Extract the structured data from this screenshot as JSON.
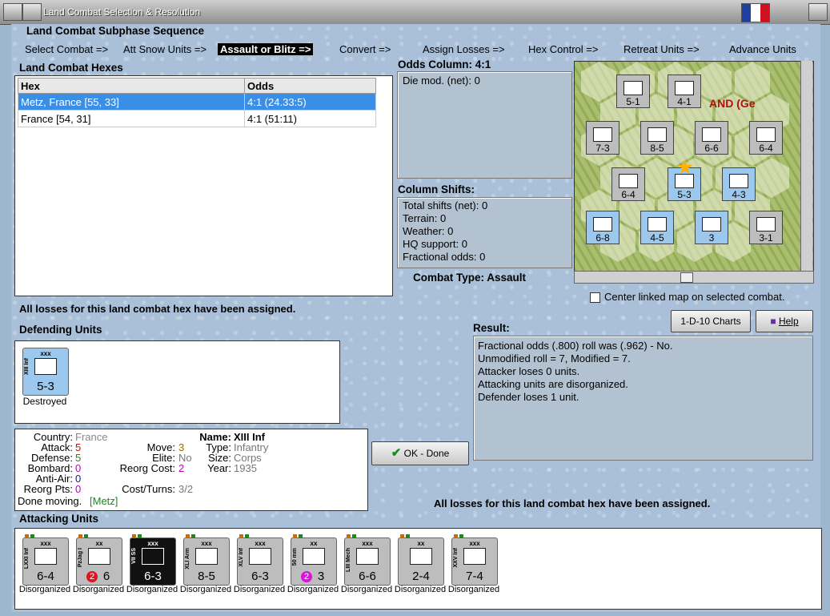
{
  "window": {
    "title": "Land Combat Selection & Resolution"
  },
  "sequence": {
    "header": "Land Combat Subphase Sequence",
    "steps": [
      "Select Combat =>",
      "Att Snow Units =>",
      "Assault or Blitz =>",
      "Convert =>",
      "Assign Losses =>",
      "Hex Control =>",
      "Retreat Units =>",
      "Advance Units"
    ],
    "active_index": 2
  },
  "hexes": {
    "header": "Land Combat Hexes",
    "columns": [
      "Hex",
      "Odds"
    ],
    "rows": [
      {
        "hex": "Metz, France [55, 33]",
        "odds": "4:1 (24.33:5)"
      },
      {
        "hex": "France [54, 31]",
        "odds": "4:1 (51:11)"
      }
    ]
  },
  "odds": {
    "label": "Odds Column: 4:1",
    "die_mod": "Die mod. (net): 0"
  },
  "shifts": {
    "header": "Column Shifts:",
    "lines": [
      "Total shifts (net): 0",
      "Terrain: 0",
      "Weather: 0",
      "HQ support: 0",
      "Fractional odds: 0"
    ]
  },
  "combat_type": "Combat Type:  Assault",
  "map": {
    "overlay_text": "AND (Ge",
    "center_label": "Center linked map on selected combat.",
    "units": [
      {
        "size": "xxx",
        "str": "5-1"
      },
      {
        "size": "xxx",
        "str": "4-1"
      },
      {
        "size": "xxx",
        "str": "7-3"
      },
      {
        "size": "xxx",
        "str": "8-5"
      },
      {
        "size": "xxx",
        "str": "6-6"
      },
      {
        "size": "xxx",
        "str": "6-4"
      },
      {
        "size": "xxx",
        "str": "6-4"
      },
      {
        "size": "xxx",
        "str": "5-3"
      },
      {
        "size": "xxx",
        "str": "4-3"
      },
      {
        "size": "xxx",
        "str": "6-8"
      },
      {
        "size": "xxx",
        "str": "4-5"
      },
      {
        "size": "xx",
        "str": "3"
      },
      {
        "size": "xxx",
        "str": "3-1"
      }
    ]
  },
  "losses_msg": "All losses for this land combat hex have been assigned.",
  "defending": {
    "header": "Defending Units",
    "units": [
      {
        "size": "xxx",
        "name": "XIII Inf",
        "str": "5-3",
        "status": "Destroyed"
      }
    ]
  },
  "unit_info": {
    "country_label": "Country:",
    "country": "France",
    "attack_label": "Attack:",
    "attack": "5",
    "defense_label": "Defense:",
    "defense": "5",
    "bombard_label": "Bombard:",
    "bombard": "0",
    "antiair_label": "Anti-Air:",
    "antiair": "0",
    "reorg_pts_label": "Reorg Pts:",
    "reorg_pts": "0",
    "move_label": "Move:",
    "move": "3",
    "elite_label": "Elite:",
    "elite": "No",
    "reorg_cost_label": "Reorg Cost:",
    "reorg_cost": "2",
    "cost_turns_label": "Cost/Turns:",
    "cost_turns": "3/2",
    "name_label": "Name:",
    "name": "XIII Inf",
    "type_label": "Type:",
    "type": "Infantry",
    "size_label": "Size:",
    "size": "Corps",
    "year_label": "Year:",
    "year": "1935",
    "done_label": "Done moving.",
    "done_loc": "[Metz]"
  },
  "buttons": {
    "charts": "1-D-10 Charts",
    "help": "Help",
    "ok": "OK - Done"
  },
  "result": {
    "header": "Result:",
    "lines": [
      "Fractional odds (.800) roll was (.962)  - No.",
      "Unmodified roll = 7, Modified = 7.",
      "Attacker loses 0 units.",
      "Attacking units are disorganized.",
      "Defender loses 1 unit."
    ]
  },
  "attacking": {
    "header": "Attacking Units",
    "units": [
      {
        "size": "xxx",
        "name": "LXXI Inf",
        "str": "6-4",
        "status": "Disorganized",
        "style": "gray"
      },
      {
        "size": "xx",
        "name": "PzJag I",
        "str": "6",
        "badge": "2",
        "badge_color": "#e0141e",
        "status": "Disorganized",
        "style": "gray"
      },
      {
        "size": "xxx",
        "name": "VII SS",
        "str": "6-3",
        "status": "Disorganized",
        "style": "black"
      },
      {
        "size": "xxx",
        "name": "XLI Arm",
        "str": "8-5",
        "status": "Disorganized",
        "style": "gray"
      },
      {
        "size": "xxx",
        "name": "XLV Inf",
        "str": "6-3",
        "status": "Disorganized",
        "style": "gray"
      },
      {
        "size": "xx",
        "name": "50 mm",
        "str": "3",
        "badge": "2",
        "badge_color": "#e010e0",
        "status": "Disorganized",
        "style": "gray"
      },
      {
        "size": "xxx",
        "name": "LIII Mech",
        "str": "6-6",
        "status": "Disorganized",
        "style": "gray"
      },
      {
        "size": "xx",
        "name": "",
        "str": "2-4",
        "status": "Disorganized",
        "style": "gray"
      },
      {
        "size": "xxx",
        "name": "XXV Inf",
        "str": "7-4",
        "status": "Disorganized",
        "style": "gray"
      }
    ]
  },
  "colors": {
    "accent": "#3a8ee6",
    "attack": "#c81010",
    "defense": "#1a8a1a",
    "move": "#a06a00",
    "bombard": "#c000c0",
    "antiair": "#1010c0",
    "elite": "#555555",
    "done_loc": "#1a8a1a",
    "flag": [
      "#2040a0",
      "#ffffff",
      "#d01020"
    ]
  }
}
